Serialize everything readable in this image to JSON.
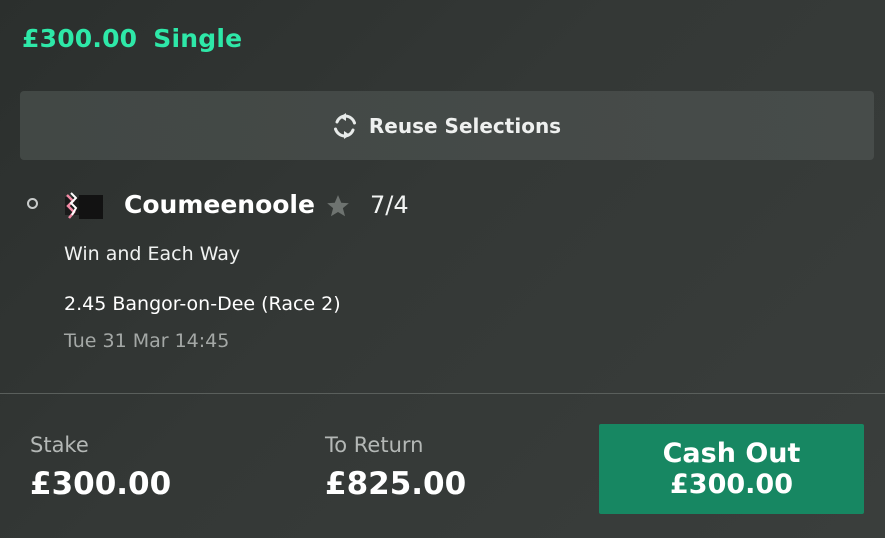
{
  "bet": {
    "amount": "£300.00",
    "type": "Single"
  },
  "reuse": {
    "label": "Reuse Selections",
    "icon": "refresh-icon"
  },
  "selection": {
    "runner": "Coumeenoole",
    "odds": "7/4",
    "market": "Win and Each Way",
    "event": "2.45 Bangor-on-Dee (Race 2)",
    "time": "Tue 31 Mar 14:45"
  },
  "footer": {
    "stake_label": "Stake",
    "stake_value": "£300.00",
    "return_label": "To Return",
    "return_value": "£825.00",
    "cashout_label": "Cash Out",
    "cashout_value": "£300.00"
  },
  "colors": {
    "accent": "#2ee8a8",
    "cashout": "#178762"
  }
}
